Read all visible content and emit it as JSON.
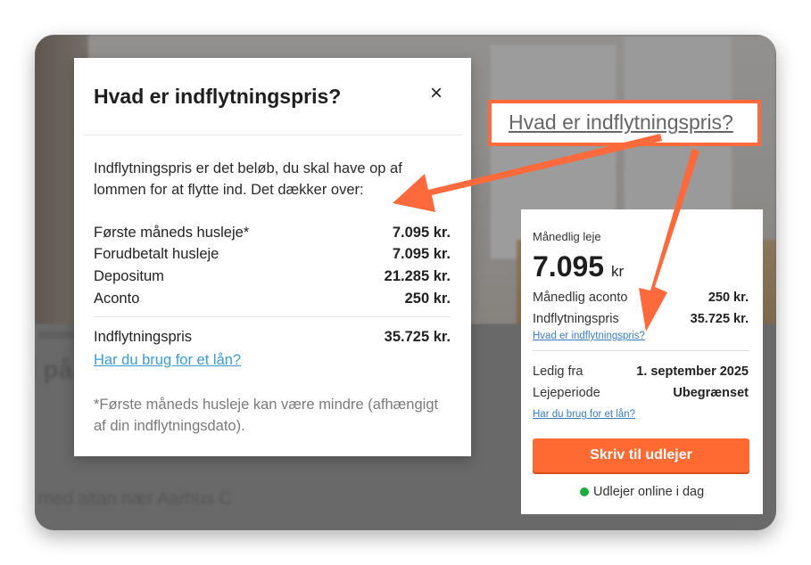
{
  "modal": {
    "title": "Hvad er indflytningspris?",
    "close": "×",
    "intro": "Indflytningspris er det beløb, du skal have op af lommen for at flytte ind. Det dækker over:",
    "rows": [
      {
        "label": "Første måneds husleje*",
        "value": "7.095 kr."
      },
      {
        "label": "Forudbetalt husleje",
        "value": "7.095 kr."
      },
      {
        "label": "Depositum",
        "value": "21.285 kr."
      },
      {
        "label": "Aconto",
        "value": "250 kr."
      }
    ],
    "total": {
      "label": "Indflytningspris",
      "value": "35.725 kr."
    },
    "loan_link": "Har du brug for et lån?",
    "footnote": "*Første måneds husleje kan være mindre (afhængigt af din indflytningsdato)."
  },
  "highlight_link": "Hvad er indflytningspris?",
  "card": {
    "monthly_rent_label": "Månedlig leje",
    "monthly_rent_value": "7.095",
    "monthly_rent_unit": "kr",
    "aconto_label": "Månedlig aconto",
    "aconto_value": "250 kr.",
    "movein_label": "Indflytningspris",
    "movein_value": "35.725 kr.",
    "movein_link": "Hvad er indflytningspris?",
    "available_label": "Ledig fra",
    "available_value": "1. september 2025",
    "period_label": "Lejeperiode",
    "period_value": "Ubegrænset",
    "loan_link": "Har du brug for et lån?",
    "cta": "Skriv til udlejer",
    "online": "Udlejer online i dag"
  },
  "background": {
    "title_fragment": "l på",
    "subtitle_fragment": "med altan nær Aarhus C"
  },
  "colors": {
    "accent": "#ff6a33",
    "link": "#3a9bd9",
    "online": "#1cac3f"
  }
}
